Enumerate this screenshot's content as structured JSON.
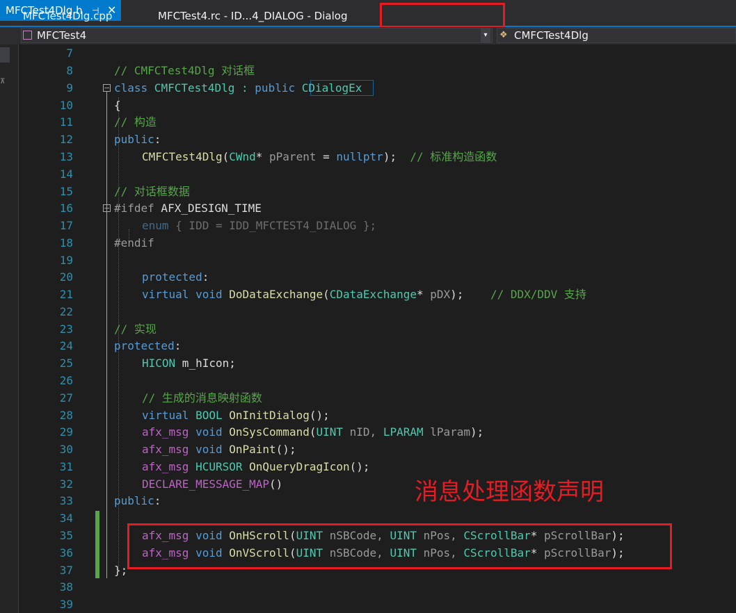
{
  "tabs": [
    {
      "label": "MFCTest4Dlg.cpp",
      "active": false
    },
    {
      "label": "MFCTest4.rc - ID...4_DIALOG - Dialog",
      "active": false
    },
    {
      "label": "MFCTest4Dlg.h",
      "active": true
    }
  ],
  "tab_pin_glyph": "⊣",
  "tab_close_glyph": "✕",
  "nav": {
    "project": "MFCTest4",
    "class_scope": "CMFCTest4Dlg"
  },
  "editor": {
    "line_numbers": [
      "7",
      "8",
      "9",
      "10",
      "11",
      "12",
      "13",
      "14",
      "15",
      "16",
      "17",
      "18",
      "19",
      "20",
      "21",
      "22",
      "23",
      "24",
      "25",
      "26",
      "27",
      "28",
      "29",
      "30",
      "31",
      "32",
      "33",
      "34",
      "35",
      "36",
      "37",
      "38",
      "39"
    ],
    "lines": {
      "l8": "// CMFCTest4Dlg 对话框",
      "l9_kw": "class",
      "l9_name": " CMFCTest4Dlg : ",
      "l9_pub": "public",
      "l9_base": "CDialogEx",
      "l10": "{",
      "l11": "// 构造",
      "l12": "public",
      "l12_colon": ":",
      "l13_fn": "CMFCTest4Dlg",
      "l13_p1": "(",
      "l13_ty": "CWnd",
      "l13_p2": "* ",
      "l13_param": "pParent",
      "l13_p3": " = ",
      "l13_null": "nullptr",
      "l13_p4": ");  ",
      "l13_cm": "// 标准构造函数",
      "l15": "// 对话框数据",
      "l16_pp": "#ifdef",
      "l16_sym": " AFX_DESIGN_TIME",
      "l17_kw": "enum",
      "l17_rest": " { IDD = IDD_MFCTEST4_DIALOG };",
      "l18": "#endif",
      "l20_kw": "protected",
      "l20_colon": ":",
      "l21_kw": "virtual void",
      "l21_fn": " DoDataExchange",
      "l21_p1": "(",
      "l21_ty": "CDataExchange",
      "l21_p2": "* ",
      "l21_param": "pDX",
      "l21_p3": ");    ",
      "l21_cm": "// DDX/DDV 支持",
      "l23": "// 实现",
      "l24_kw": "protected",
      "l24_colon": ":",
      "l25_ty": "HICON",
      "l25_rest": " m_hIcon;",
      "l27": "// 生成的消息映射函数",
      "l28_kw": "virtual",
      "l28_ty": " BOOL",
      "l28_fn": " OnInitDialog",
      "l28_rest": "();",
      "l29_mac": "afx_msg",
      "l29_kw": " void",
      "l29_fn": " OnSysCommand",
      "l29_p1": "(",
      "l29_ty1": "UINT",
      "l29_a1": " nID, ",
      "l29_ty2": "LPARAM",
      "l29_a2": " lParam",
      "l29_p2": ");",
      "l30_mac": "afx_msg",
      "l30_kw": " void",
      "l30_fn": " OnPaint",
      "l30_rest": "();",
      "l31_mac": "afx_msg",
      "l31_ty": " HCURSOR",
      "l31_fn": " OnQueryDragIcon",
      "l31_rest": "();",
      "l32_mac": "DECLARE_MESSAGE_MAP",
      "l32_rest": "()",
      "l33_kw": "public",
      "l33_colon": ":",
      "l35_mac": "afx_msg",
      "l35_kw": " void",
      "l35_fn": " OnHScroll",
      "l35_p1": "(",
      "l35_ty1": "UINT",
      "l35_a1": " nSBCode, ",
      "l35_ty2": "UINT",
      "l35_a2": " nPos, ",
      "l35_ty3": "CScrollBar",
      "l35_a3": "* ",
      "l35_param": "pScrollBar",
      "l35_p2": ");",
      "l36_mac": "afx_msg",
      "l36_kw": " void",
      "l36_fn": " OnVScroll",
      "l36_p1": "(",
      "l36_ty1": "UINT",
      "l36_a1": " nSBCode, ",
      "l36_ty2": "UINT",
      "l36_a2": " nPos, ",
      "l36_ty3": "CScrollBar",
      "l36_a3": "* ",
      "l36_param": "pScrollBar",
      "l36_p2": ");",
      "l37": "};"
    }
  },
  "annotation": "消息处理函数声明",
  "colors": {
    "highlight_box": "#e51c23",
    "keyword": "#569cd6",
    "type": "#4ec9b0",
    "comment": "#57a64a",
    "function": "#dcdcaa",
    "macro": "#bd63c5",
    "line_number": "#2b91af",
    "active_tab": "#007acc",
    "change_bar": "#57a64a"
  },
  "icons": {
    "left_close": "close-icon",
    "left_dropdown": "chevron-down-icon",
    "project": "project-icon",
    "class": "class-icon"
  }
}
